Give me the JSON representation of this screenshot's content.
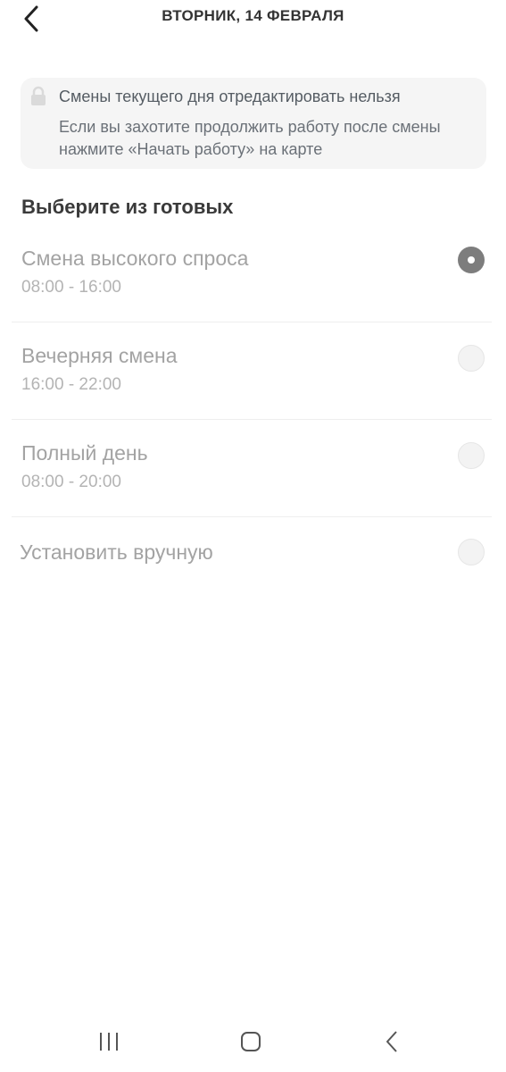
{
  "header": {
    "title": "ВТОРНИК, 14 ФЕВРАЛЯ"
  },
  "notice": {
    "title": "Смены текущего дня отредактировать нельзя",
    "text": "Если вы захотите продолжить работу после смены нажмите «Начать работу» на карте",
    "icon": "lock-icon"
  },
  "section": {
    "title": "Выберите из готовых"
  },
  "options": [
    {
      "name": "Смена высокого спроса",
      "time": "08:00 - 16:00",
      "selected": true
    },
    {
      "name": "Вечерняя смена",
      "time": "16:00 - 22:00",
      "selected": false
    },
    {
      "name": "Полный день",
      "time": "08:00 - 20:00",
      "selected": false
    },
    {
      "name": "Установить вручную",
      "time": "",
      "selected": false
    }
  ],
  "colors": {
    "selected_radio": "#7d7d7d",
    "notice_bg": "#f5f5f5"
  },
  "navbar": {
    "icons": [
      "recent-apps-icon",
      "home-icon",
      "back-icon"
    ]
  }
}
